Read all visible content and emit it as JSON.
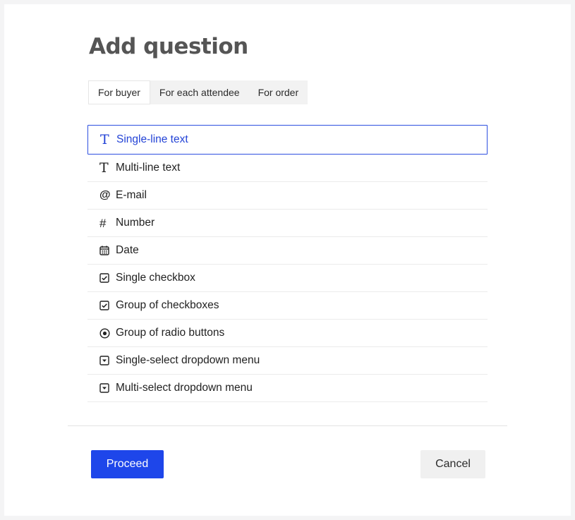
{
  "dialog": {
    "title": "Add question"
  },
  "tabs": [
    {
      "label": "For buyer",
      "active": true
    },
    {
      "label": "For each attendee",
      "active": false
    },
    {
      "label": "For order",
      "active": false
    }
  ],
  "question_types": [
    {
      "label": "Single-line text",
      "icon": "text-icon",
      "selected": true
    },
    {
      "label": "Multi-line text",
      "icon": "text-icon",
      "selected": false
    },
    {
      "label": "E-mail",
      "icon": "at-icon",
      "selected": false
    },
    {
      "label": "Number",
      "icon": "hash-icon",
      "selected": false
    },
    {
      "label": "Date",
      "icon": "calendar-icon",
      "selected": false
    },
    {
      "label": "Single checkbox",
      "icon": "checkbox-icon",
      "selected": false
    },
    {
      "label": "Group of checkboxes",
      "icon": "checkbox-icon",
      "selected": false
    },
    {
      "label": "Group of radio buttons",
      "icon": "radio-icon",
      "selected": false
    },
    {
      "label": "Single-select dropdown menu",
      "icon": "dropdown-icon",
      "selected": false
    },
    {
      "label": "Multi-select dropdown menu",
      "icon": "dropdown-icon",
      "selected": false
    }
  ],
  "icon_glyphs": {
    "text": "T",
    "at": "@",
    "hash": "#"
  },
  "actions": {
    "proceed_label": "Proceed",
    "cancel_label": "Cancel"
  },
  "colors": {
    "accent": "#1e46ea",
    "selected_text": "#2343d6",
    "title": "#555555"
  }
}
